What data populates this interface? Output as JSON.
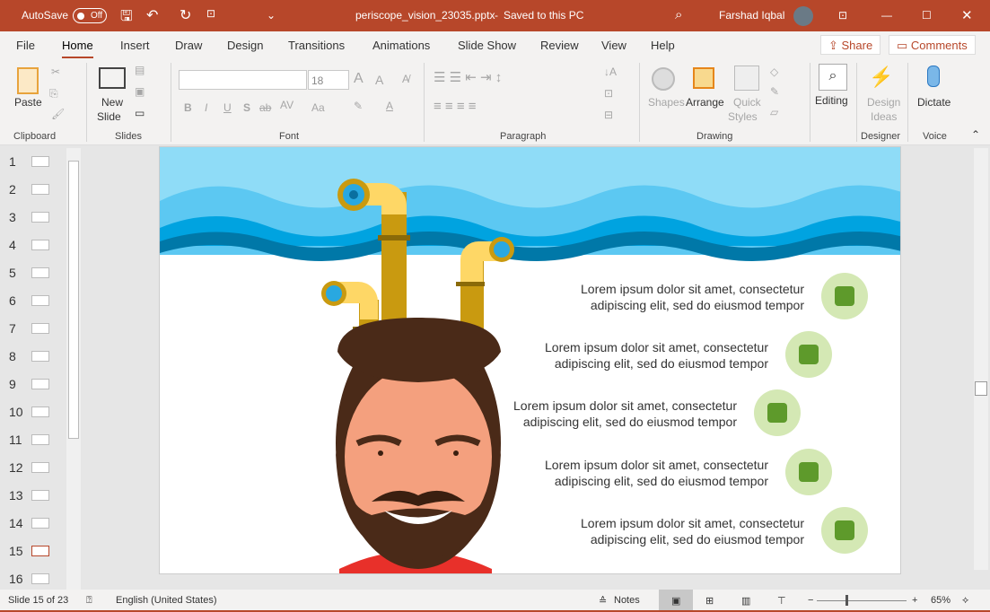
{
  "titlebar": {
    "autosave": "AutoSave",
    "autosave_state": "Off",
    "filename": "periscope_vision_23035.pptx",
    "save_status": "Saved to this PC",
    "separator": "-",
    "user": "Farshad Iqbal"
  },
  "tabs": [
    "File",
    "Home",
    "Insert",
    "Draw",
    "Design",
    "Transitions",
    "Animations",
    "Slide Show",
    "Review",
    "View",
    "Help"
  ],
  "active_tab": "Home",
  "share": "Share",
  "comments": "Comments",
  "ribbon": {
    "paste": "Paste",
    "new": "New",
    "slide": "Slide",
    "font_size": "18",
    "font_name": "",
    "shapes": "Shapes",
    "arrange": "Arrange",
    "quick": "Quick",
    "styles": "Styles",
    "editing": "Editing",
    "design": "Design",
    "ideas": "Ideas",
    "dictate": "Dictate",
    "groups": {
      "clipboard": "Clipboard",
      "slides": "Slides",
      "font": "Font",
      "paragraph": "Paragraph",
      "drawing": "Drawing",
      "designer": "Designer",
      "voice": "Voice"
    },
    "font_buttons": [
      "B",
      "I",
      "U",
      "S",
      "ab",
      "AV",
      "Aa"
    ]
  },
  "thumbnails": [
    "1",
    "2",
    "3",
    "4",
    "5",
    "6",
    "7",
    "8",
    "9",
    "10",
    "11",
    "12",
    "13",
    "14",
    "15",
    "16"
  ],
  "current_slide": 15,
  "slide": {
    "items": [
      {
        "line1": "Lorem ipsum dolor sit amet, consectetur",
        "line2": "adipiscing elit, sed do eiusmod tempor",
        "icon": "head-document-icon"
      },
      {
        "line1": "Lorem ipsum dolor sit amet, consectetur",
        "line2": "adipiscing elit, sed do eiusmod tempor",
        "icon": "map-pin-icon"
      },
      {
        "line1": "Lorem ipsum dolor sit amet, consectetur",
        "line2": "adipiscing elit, sed do eiusmod tempor",
        "icon": "checklist-icon"
      },
      {
        "line1": "Lorem ipsum dolor sit amet, consectetur",
        "line2": "adipiscing elit, sed do eiusmod tempor",
        "icon": "growth-chart-icon"
      },
      {
        "line1": "Lorem ipsum dolor sit amet, consectetur",
        "line2": "adipiscing elit, sed do eiusmod tempor",
        "icon": "user-star-icon"
      }
    ]
  },
  "status": {
    "slide": "Slide 15 of 23",
    "language": "English (United States)",
    "notes": "Notes",
    "zoom": "65%"
  },
  "colors": {
    "accent": "#b7472a",
    "icon_bg": "#d4e8b4",
    "icon_fg": "#5e9a2b"
  }
}
